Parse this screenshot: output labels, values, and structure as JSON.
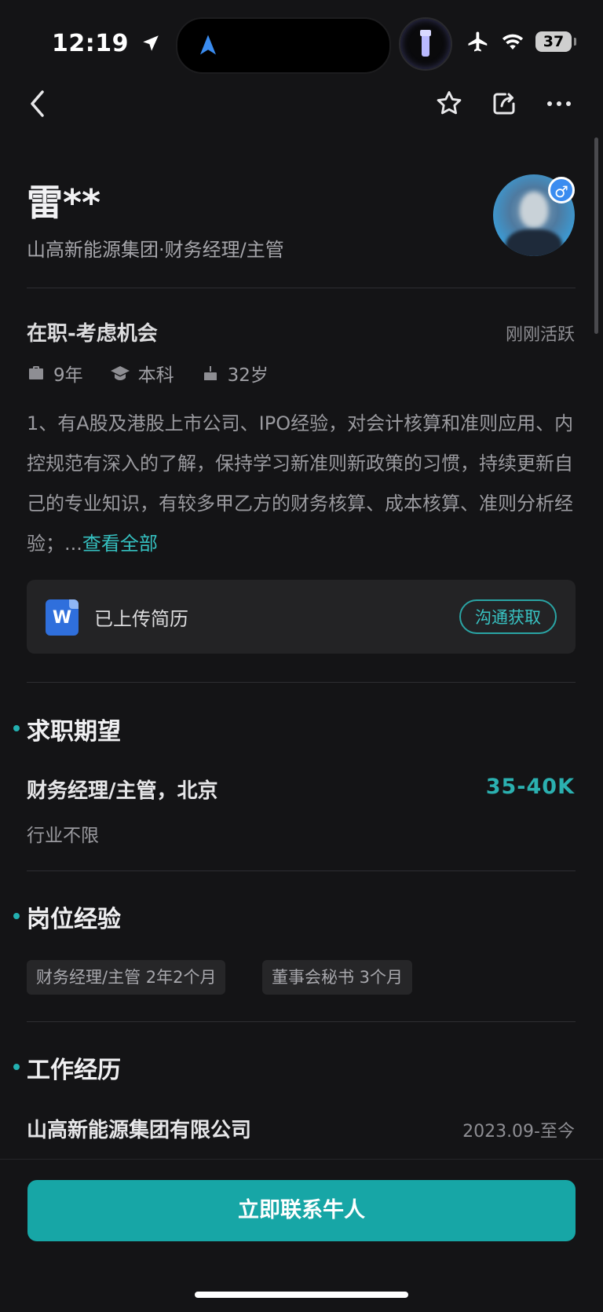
{
  "status_bar": {
    "time": "12:19",
    "battery": "37"
  },
  "profile": {
    "name": "雷**",
    "company_position": "山高新能源集团·财务经理/主管",
    "job_status": "在职-考虑机会",
    "activity": "刚刚活跃",
    "experience_years": "9年",
    "education": "本科",
    "age": "32岁",
    "summary": "1、有A股及港股上市公司、IPO经验，对会计核算和准则应用、内控规范有深入的了解，保持学习新准则新政策的习惯，持续更新自己的专业知识，有较多甲乙方的财务核算、成本核算、准则分析经验；...",
    "see_all": "查看全部"
  },
  "resume": {
    "label": "已上传简历",
    "action": "沟通获取"
  },
  "sections": {
    "expectation": {
      "title": "求职期望",
      "job": "财务经理/主管，北京",
      "salary": "35-40K",
      "industry": "行业不限"
    },
    "position_experience": {
      "title": "岗位经验",
      "tags": [
        "财务经理/主管 2年2个月",
        "董事会秘书 3个月"
      ]
    },
    "work_history": {
      "title": "工作经历",
      "company": "山高新能源集团有限公司",
      "date": "2023.09-至今"
    }
  },
  "cta": {
    "label": "立即联系牛人"
  },
  "colors": {
    "accent": "#17a6a6",
    "background": "#141416",
    "link": "#35c0c0"
  }
}
